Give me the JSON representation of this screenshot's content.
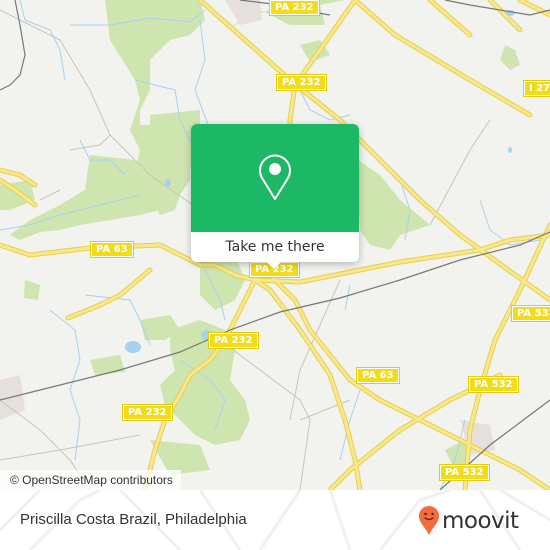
{
  "map": {
    "colors": {
      "background": "#f2f2ee",
      "park": "#cfe5b0",
      "water": "#a7d1ef",
      "road": "#f5e27a",
      "road_casing": "#e8cf4a",
      "minor_road": "#c9c4bc",
      "rail": "#777777",
      "shield": "#f2dc1a"
    },
    "road_labels": [
      {
        "id": "pa232-top",
        "text": "PA 232"
      },
      {
        "id": "pa232-upper",
        "text": "PA 232"
      },
      {
        "id": "i276",
        "text": "I 27"
      },
      {
        "id": "pa63-west",
        "text": "PA 63"
      },
      {
        "id": "pa232-center",
        "text": "PA 232"
      },
      {
        "id": "pa532-east",
        "text": "PA 532"
      },
      {
        "id": "pa232-mid",
        "text": "PA 232"
      },
      {
        "id": "pa63-south",
        "text": "PA 63"
      },
      {
        "id": "pa532-south",
        "text": "PA 532"
      },
      {
        "id": "pa232-southwest",
        "text": "PA 232"
      },
      {
        "id": "pa532-bottom",
        "text": "PA 532"
      }
    ],
    "attribution": "© OpenStreetMap contributors"
  },
  "popup": {
    "icon": "location-pin-icon",
    "accent_color": "#1db866",
    "button_label": "Take me there"
  },
  "footer": {
    "place_name": "Priscilla Costa Brazil, Philadelphia",
    "brand": {
      "name": "moovit",
      "logo_icon": "moovit-pin-icon",
      "logo_color": "#f26a3d"
    }
  }
}
